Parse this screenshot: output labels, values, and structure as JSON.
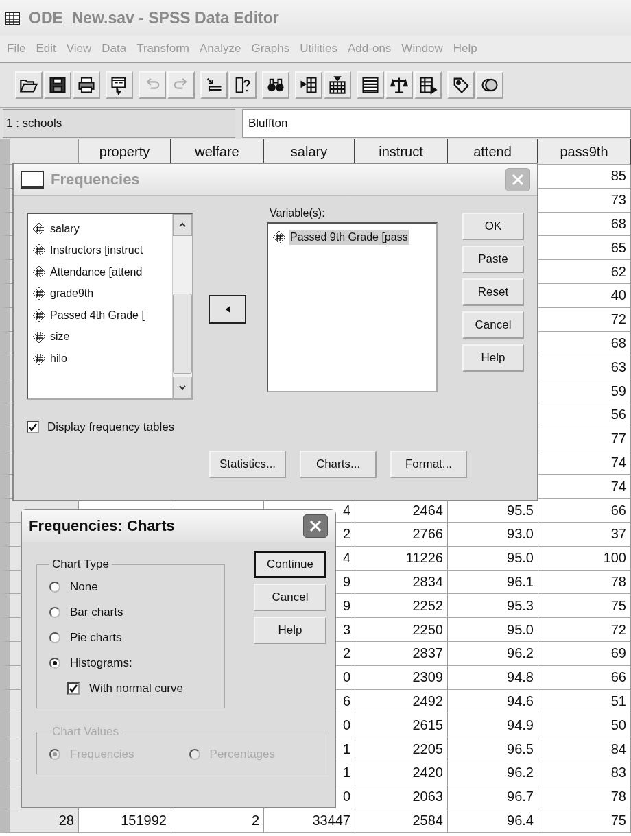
{
  "window": {
    "title": "ODE_New.sav - SPSS Data Editor"
  },
  "menu": [
    "File",
    "Edit",
    "View",
    "Data",
    "Transform",
    "Analyze",
    "Graphs",
    "Utilities",
    "Add-ons",
    "Window",
    "Help"
  ],
  "toolbar": [
    [
      {
        "kind": "open",
        "disabled": false
      },
      {
        "kind": "save",
        "disabled": false
      },
      {
        "kind": "print",
        "disabled": false
      }
    ],
    [
      {
        "kind": "recall",
        "disabled": false
      }
    ],
    [
      {
        "kind": "undo",
        "disabled": true
      },
      {
        "kind": "redo",
        "disabled": true
      }
    ],
    [
      {
        "kind": "goto",
        "disabled": false
      },
      {
        "kind": "variables",
        "disabled": false
      }
    ],
    [
      {
        "kind": "find",
        "disabled": false
      }
    ],
    [
      {
        "kind": "insert_cases",
        "disabled": false
      },
      {
        "kind": "insert_variable",
        "disabled": false
      }
    ],
    [
      {
        "kind": "split",
        "disabled": false
      },
      {
        "kind": "weight",
        "disabled": false
      },
      {
        "kind": "select",
        "disabled": false
      }
    ],
    [
      {
        "kind": "labels",
        "disabled": false
      },
      {
        "kind": "sets",
        "disabled": false
      }
    ]
  ],
  "cell_editor": {
    "cell": "1 : schools",
    "value": "Bluffton"
  },
  "grid": {
    "columns": [
      "",
      "property",
      "welfare",
      "salary",
      "instruct",
      "attend",
      "pass9th"
    ],
    "rows": [
      {
        "cells": [
          null,
          null,
          null,
          null,
          null,
          null,
          "85"
        ]
      },
      {
        "cells": [
          null,
          null,
          null,
          null,
          null,
          null,
          "73"
        ]
      },
      {
        "cells": [
          null,
          null,
          null,
          null,
          null,
          null,
          "68"
        ]
      },
      {
        "cells": [
          null,
          null,
          null,
          null,
          null,
          null,
          "65"
        ]
      },
      {
        "cells": [
          null,
          null,
          null,
          null,
          null,
          null,
          "62"
        ]
      },
      {
        "cells": [
          null,
          null,
          null,
          null,
          null,
          null,
          "40"
        ]
      },
      {
        "cells": [
          null,
          null,
          null,
          null,
          null,
          null,
          "72"
        ]
      },
      {
        "cells": [
          null,
          null,
          null,
          null,
          null,
          null,
          "68"
        ]
      },
      {
        "cells": [
          null,
          null,
          null,
          null,
          null,
          null,
          "63"
        ]
      },
      {
        "cells": [
          null,
          null,
          null,
          null,
          null,
          null,
          "59"
        ]
      },
      {
        "cells": [
          null,
          null,
          null,
          null,
          null,
          null,
          "56"
        ]
      },
      {
        "cells": [
          null,
          null,
          null,
          null,
          null,
          null,
          "77"
        ]
      },
      {
        "cells": [
          null,
          null,
          null,
          null,
          null,
          null,
          "74"
        ]
      },
      {
        "cells": [
          null,
          null,
          null,
          null,
          null,
          null,
          "74"
        ]
      },
      {
        "cells": [
          null,
          null,
          null,
          "4",
          "2464",
          "95.5",
          "66"
        ]
      },
      {
        "cells": [
          null,
          null,
          null,
          "2",
          "2766",
          "93.0",
          "37"
        ]
      },
      {
        "cells": [
          null,
          null,
          null,
          "4",
          "11226",
          "95.0",
          "100"
        ]
      },
      {
        "cells": [
          null,
          null,
          null,
          "9",
          "2834",
          "96.1",
          "78"
        ]
      },
      {
        "cells": [
          null,
          null,
          null,
          "9",
          "2252",
          "95.3",
          "75"
        ]
      },
      {
        "cells": [
          null,
          null,
          null,
          "3",
          "2250",
          "95.0",
          "72"
        ]
      },
      {
        "cells": [
          null,
          null,
          null,
          "2",
          "2837",
          "96.2",
          "69"
        ]
      },
      {
        "cells": [
          null,
          null,
          null,
          "0",
          "2309",
          "94.8",
          "66"
        ]
      },
      {
        "cells": [
          null,
          null,
          null,
          "6",
          "2492",
          "94.6",
          "51"
        ]
      },
      {
        "cells": [
          null,
          null,
          null,
          "0",
          "2615",
          "94.9",
          "50"
        ]
      },
      {
        "cells": [
          null,
          null,
          null,
          "1",
          "2205",
          "96.5",
          "84"
        ]
      },
      {
        "cells": [
          null,
          null,
          null,
          "1",
          "2420",
          "96.2",
          "83"
        ]
      },
      {
        "cells": [
          null,
          null,
          null,
          "0",
          "2063",
          "96.7",
          "78"
        ]
      },
      {
        "cells": [
          "28",
          "151992",
          "2",
          "33447",
          "2584",
          "96.4",
          "75"
        ]
      }
    ]
  },
  "frequencies": {
    "title": "Frequencies",
    "active": false,
    "source_list": [
      {
        "label": "salary",
        "selected": false
      },
      {
        "label": "Instructors [instruct",
        "selected": false
      },
      {
        "label": "Attendance [attend",
        "selected": false
      },
      {
        "label": "grade9th",
        "selected": false
      },
      {
        "label": "Passed 4th Grade [",
        "selected": false
      },
      {
        "label": "size",
        "selected": false
      },
      {
        "label": "hilo",
        "selected": false
      }
    ],
    "variables_label": "Variable(s):",
    "variables": [
      {
        "label": "Passed 9th Grade [pass",
        "selected": true
      }
    ],
    "buttons": [
      "OK",
      "Paste",
      "Reset",
      "Cancel",
      "Help"
    ],
    "display_tables": {
      "label": "Display frequency tables",
      "checked": true
    },
    "bottom_buttons": [
      "Statistics...",
      "Charts...",
      "Format..."
    ]
  },
  "charts_dialog": {
    "title": "Frequencies: Charts",
    "active": true,
    "chart_type": {
      "legend": "Chart Type",
      "options": [
        {
          "label": "None",
          "selected": false
        },
        {
          "label": "Bar charts",
          "selected": false
        },
        {
          "label": "Pie charts",
          "selected": false
        },
        {
          "label": "Histograms:",
          "selected": true
        }
      ],
      "normal_curve": {
        "label": "With normal curve",
        "checked": true
      }
    },
    "buttons": [
      {
        "label": "Continue",
        "default": true
      },
      {
        "label": "Cancel",
        "default": false
      },
      {
        "label": "Help",
        "default": false
      }
    ],
    "chart_values": {
      "legend": "Chart Values",
      "disabled": true,
      "options": [
        {
          "label": "Frequencies",
          "selected": true
        },
        {
          "label": "Percentages",
          "selected": false
        }
      ]
    }
  }
}
